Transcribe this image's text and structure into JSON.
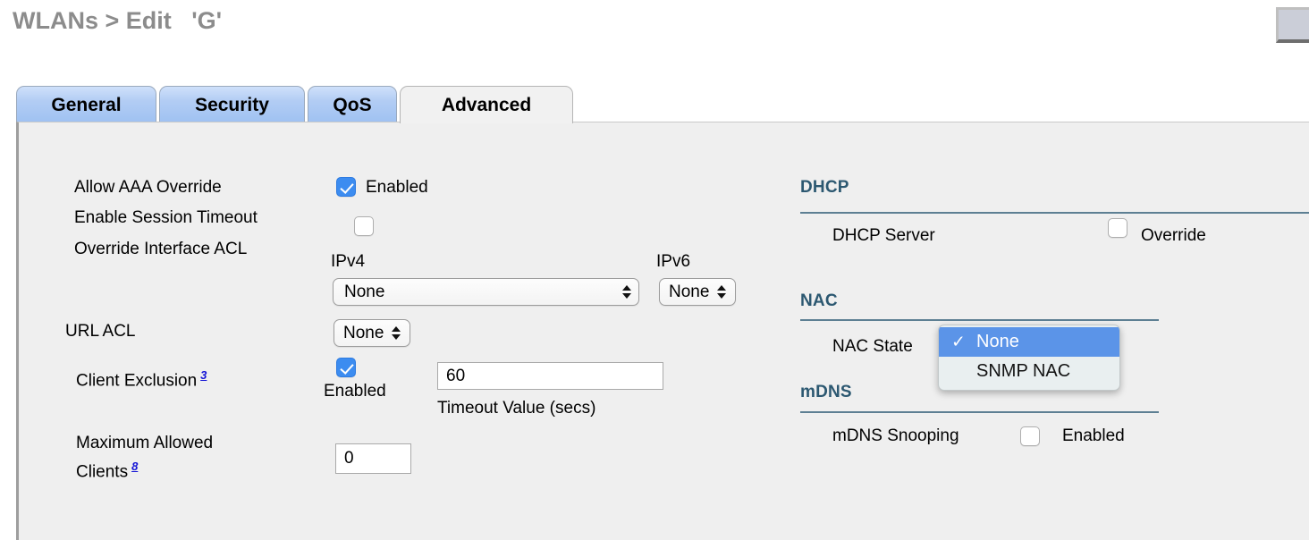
{
  "header": {
    "title": "WLANs > Edit   'G'",
    "corner_button": "corner-button"
  },
  "tabs": [
    {
      "label": "General",
      "active": false
    },
    {
      "label": "Security",
      "active": false
    },
    {
      "label": "QoS",
      "active": false
    },
    {
      "label": "Advanced",
      "active": true
    }
  ],
  "left_column": {
    "allow_aaa_override": {
      "label": "Allow AAA Override",
      "checkbox_label": "Enabled",
      "checked": true
    },
    "enable_session_timeout": {
      "label": "Enable Session Timeout",
      "checked": false
    },
    "override_interface_acl": {
      "label": "Override Interface ACL",
      "ipv4_label": "IPv4",
      "ipv4_value": "None",
      "ipv6_label": "IPv6",
      "ipv6_value": "None",
      "options": [
        "None"
      ]
    },
    "url_acl": {
      "label": "URL ACL",
      "value": "None",
      "options": [
        "None"
      ]
    },
    "client_exclusion": {
      "label": "Client Exclusion",
      "footnote": "3",
      "checkbox_label": "Enabled",
      "checked": true,
      "timeout_value": "60",
      "timeout_caption": "Timeout Value (secs)"
    },
    "maximum_allowed_clients": {
      "label_line1": "Maximum Allowed",
      "label_line2": "Clients",
      "footnote": "8",
      "value": "0"
    }
  },
  "right_column": {
    "dhcp": {
      "section_title": "DHCP",
      "server_label": "DHCP Server",
      "override_label": "Override",
      "override_checked": false
    },
    "nac": {
      "section_title": "NAC",
      "state_label": "NAC State",
      "selected_value": "None",
      "menu_open": true,
      "options": [
        {
          "label": "None",
          "selected": true,
          "check": "✓"
        },
        {
          "label": "SNMP NAC",
          "selected": false,
          "check": ""
        }
      ]
    },
    "mdns": {
      "section_title": "mDNS",
      "snooping_label": "mDNS Snooping",
      "enabled_label": "Enabled",
      "snooping_checked": false
    }
  },
  "colors": {
    "panel_bg": "#efefef",
    "tab_blue": "#9ec1f2",
    "section_head": "#2c5871",
    "section_rule": "#5d7f93",
    "checkbox_on": "#3c8cf0",
    "menu_highlight": "#5b94e8",
    "footnote_link": "#1313d6",
    "title_gray": "#8c8c8c"
  }
}
